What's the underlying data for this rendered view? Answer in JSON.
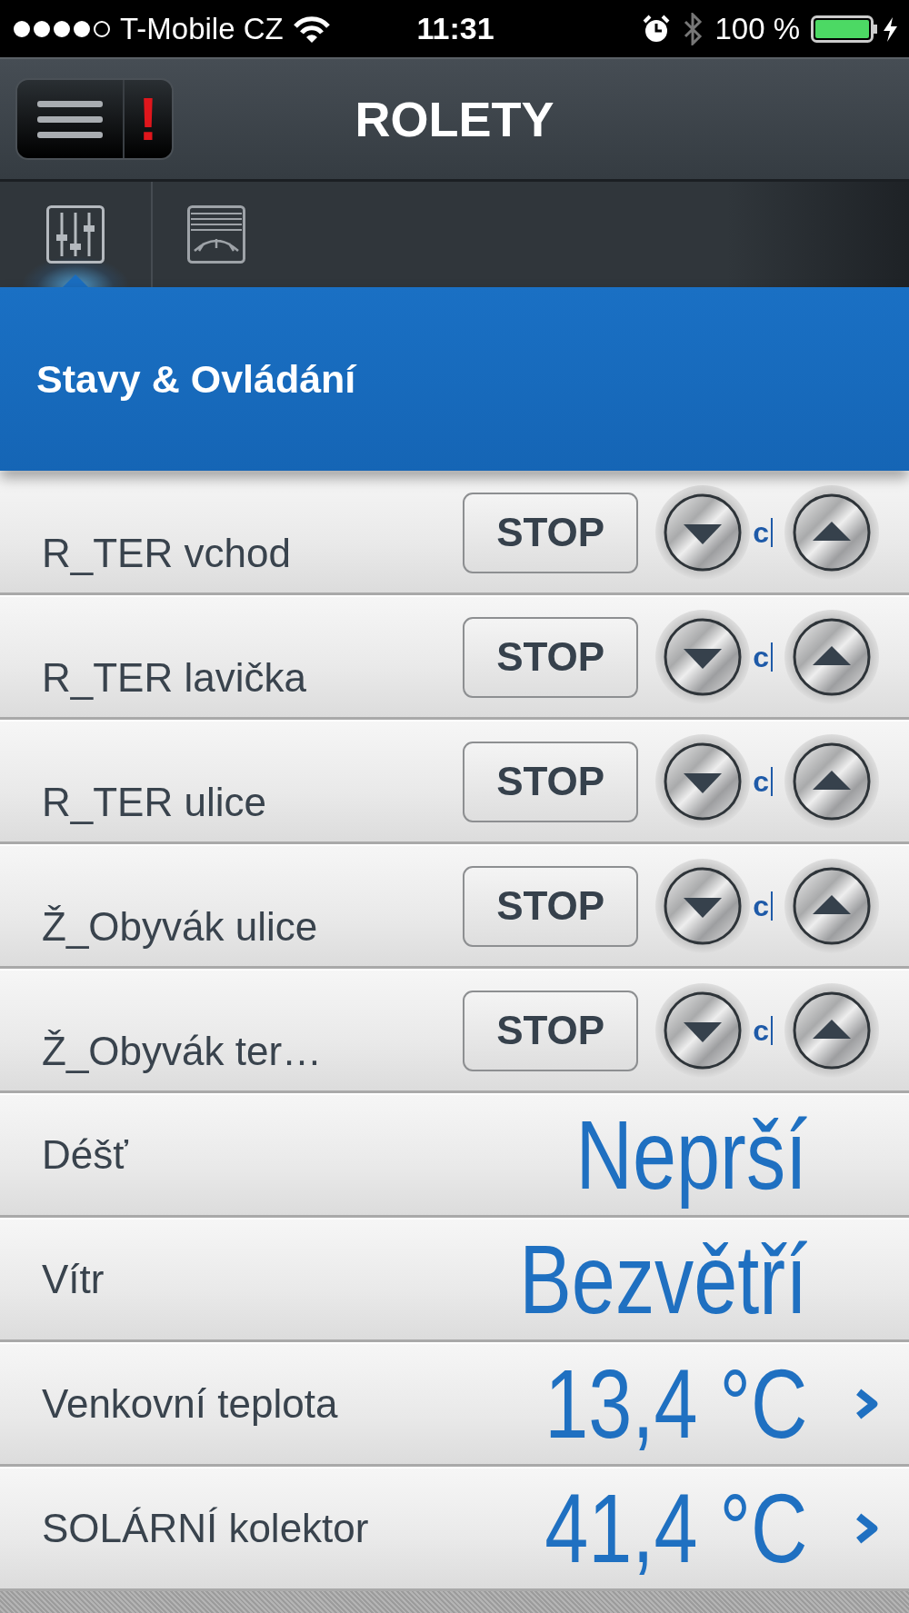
{
  "status_bar": {
    "carrier": "T-Mobile CZ",
    "time": "11:31",
    "battery": "100 %"
  },
  "header": {
    "title": "ROLETY",
    "alert": "!"
  },
  "tabs": [
    {
      "kind": "sliders",
      "selected": true
    },
    {
      "kind": "blind",
      "selected": false
    }
  ],
  "section": {
    "title": "Stavy & Ovládání"
  },
  "blinds": [
    {
      "name": "R_TER vchod",
      "stop": "STOP",
      "status": "c"
    },
    {
      "name": "R_TER lavička",
      "stop": "STOP",
      "status": "c"
    },
    {
      "name": "R_TER ulice",
      "stop": "STOP",
      "status": "c"
    },
    {
      "name": "Ž_Obyvák ulice",
      "stop": "STOP",
      "status": "c"
    },
    {
      "name": "Ž_Obyvák ter…",
      "stop": "STOP",
      "status": "c"
    }
  ],
  "readings": [
    {
      "label": "Déšť",
      "value": "Neprší",
      "link": false
    },
    {
      "label": "Vítr",
      "value": "Bezvětří",
      "link": false
    },
    {
      "label": "Venkovní teplota",
      "value": "13,4 °C",
      "link": true
    },
    {
      "label": "SOLÁRNÍ kolektor",
      "value": "41,4 °C",
      "link": true
    }
  ]
}
